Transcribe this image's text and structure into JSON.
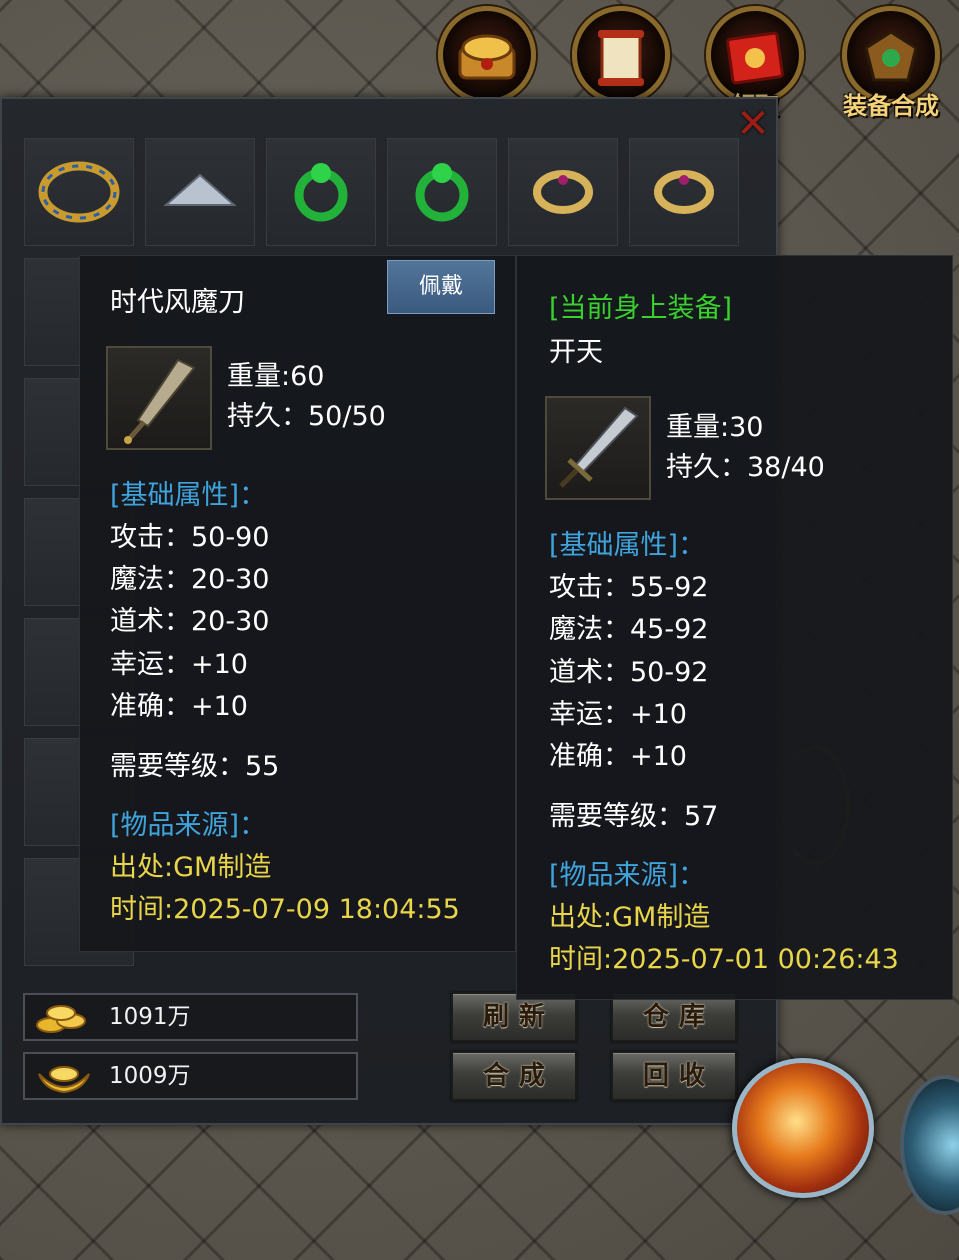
{
  "top_menu": [
    {
      "label": "",
      "icon": "treasure-chest-icon"
    },
    {
      "label": "",
      "icon": "scroll-icon"
    },
    {
      "label": "领取",
      "icon": "red-envelope-icon"
    },
    {
      "label": "装备合成",
      "icon": "equipment-emblem-icon"
    }
  ],
  "bag": {
    "close_icon": "close-x-icon",
    "top_row_items": [
      "bracelet-icon",
      "hat-icon",
      "green-ring-icon",
      "green-ring-icon",
      "gold-ring-icon",
      "gold-ring-icon"
    ]
  },
  "currency": {
    "gold": {
      "value": "1091万",
      "icon": "gold-coins-icon"
    },
    "ingot": {
      "value": "1009万",
      "icon": "gold-ingot-icon"
    }
  },
  "buttons": {
    "refresh": "刷新",
    "warehouse": "仓库",
    "synthesize": "合成",
    "recycle": "回收",
    "wear": "佩戴"
  },
  "tooltip_item": {
    "name": "时代风魔刀",
    "weight": "重量:60",
    "durability": "持久：50/50",
    "basic_header": "[基础属性]：",
    "attack": "攻击：50-90",
    "magic": "魔法：20-30",
    "taoism": "道术：20-30",
    "luck": "幸运：+10",
    "accuracy": "准确：+10",
    "req_level": "需要等级：55",
    "source_header": "[物品来源]：",
    "origin": "出处:GM制造",
    "time": "时间:2025-07-09 18:04:55"
  },
  "tooltip_equipped": {
    "header": "[当前身上装备]",
    "name": "开天",
    "weight": "重量:30",
    "durability": "持久：38/40",
    "basic_header": "[基础属性]：",
    "attack": "攻击：55-92",
    "magic": "魔法：45-92",
    "taoism": "道术：50-92",
    "luck": "幸运：+10",
    "accuracy": "准确：+10",
    "req_level": "需要等级：57",
    "source_header": "[物品来源]：",
    "origin": "出处:GM制造",
    "time": "时间:2025-07-01 00:26:43"
  },
  "colors": {
    "attribute_header": "#3fa3dc",
    "source_text": "#e9d54a",
    "equipped_header": "#39d12d",
    "close": "#9b1e16"
  }
}
